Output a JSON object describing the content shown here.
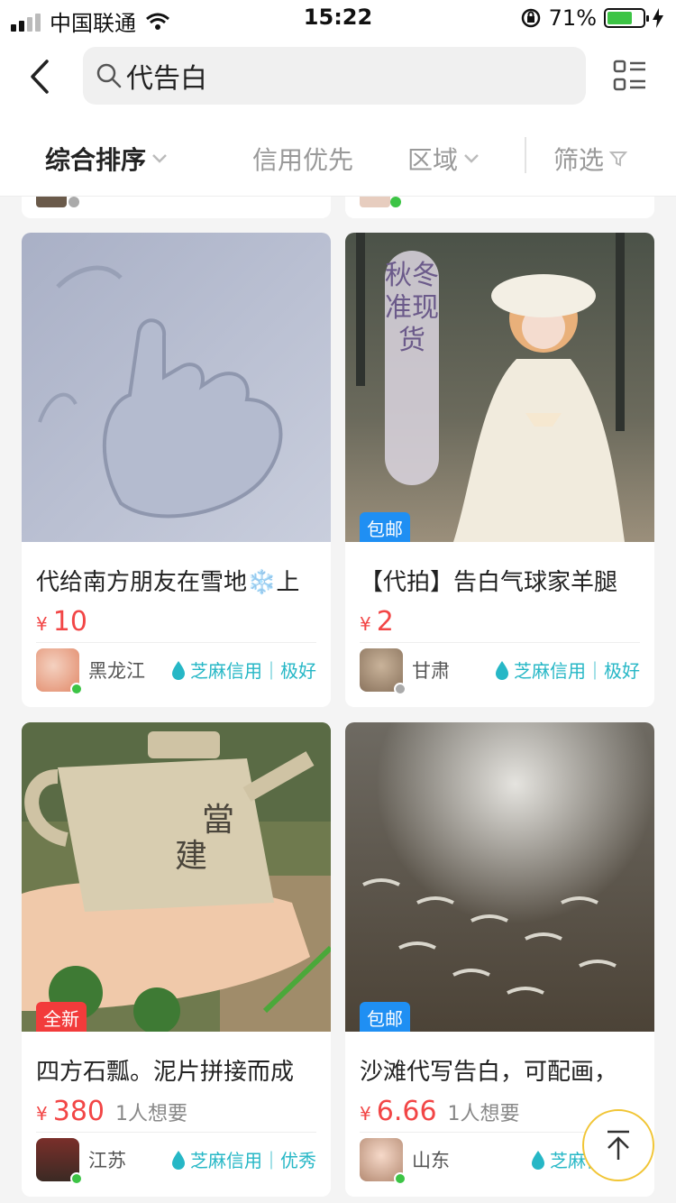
{
  "status_bar": {
    "carrier": "中国联通",
    "time": "15:22",
    "battery_percent": "71%",
    "battery_level": 0.71
  },
  "search": {
    "query": "代告白"
  },
  "sort_bar": {
    "items": [
      {
        "label": "综合排序",
        "active": true
      },
      {
        "label": "信用优先",
        "active": false
      },
      {
        "label": "区域",
        "active": false
      },
      {
        "label": "筛选",
        "active": false
      }
    ]
  },
  "products": [
    {
      "title": "代给南方朋友在雪地❄️上",
      "price": "10",
      "currency": "¥",
      "wants": "",
      "tag": "",
      "region": "黑龙江",
      "online": true,
      "credit": "芝麻信用｜极好"
    },
    {
      "title": "【代拍】告白气球家羊腿",
      "price": "2",
      "currency": "¥",
      "wants": "",
      "tag": "包邮",
      "image_text": "秋冬准现货",
      "region": "甘肃",
      "online": false,
      "credit": "芝麻信用｜极好"
    },
    {
      "title": "四方石瓢。泥片拼接而成",
      "price": "380",
      "currency": "¥",
      "wants": "1人想要",
      "tag": "全新",
      "region": "江苏",
      "online": true,
      "credit": "芝麻信用｜优秀"
    },
    {
      "title": "沙滩代写告白，可配画，",
      "price": "6.66",
      "currency": "¥",
      "wants": "1人想要",
      "tag": "包邮",
      "region": "山东",
      "online": true,
      "credit": "芝麻信用｜"
    }
  ],
  "colors": {
    "price": "#f24646",
    "credit": "#26b7c6",
    "tag_blue": "#1f8ff3",
    "tag_red": "#f23b3b",
    "online": "#3cc445"
  }
}
